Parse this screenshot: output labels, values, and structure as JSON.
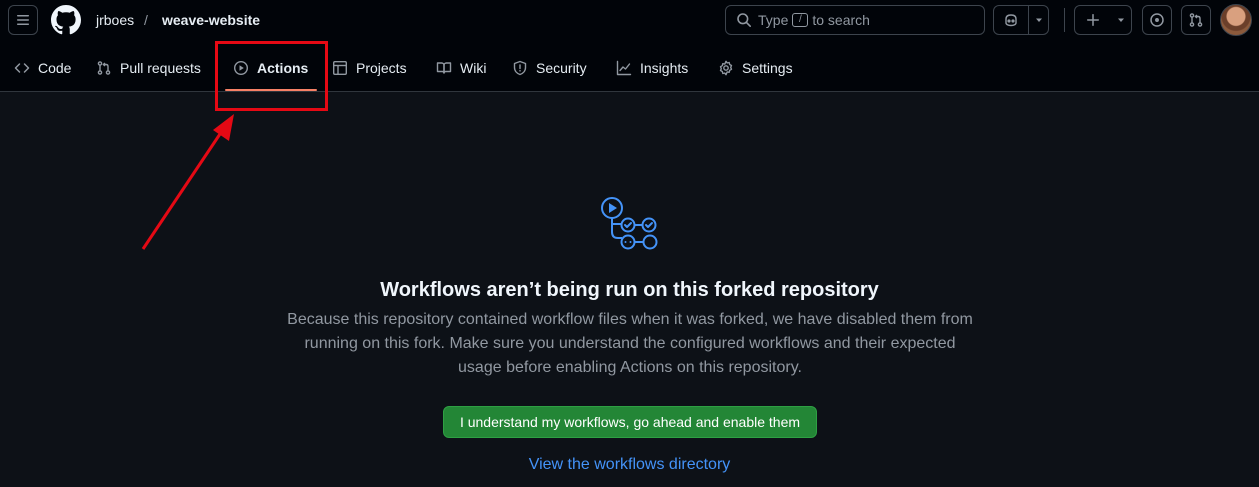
{
  "header": {
    "owner": "jrboes",
    "separator": "/",
    "repo": "weave-website",
    "search_prefix": "Type",
    "search_key": "/",
    "search_suffix": "to search",
    "icons": [
      "hamburger-menu-icon",
      "github-logo",
      "search-icon",
      "copilot-icon",
      "chevron-down-icon",
      "plus-icon",
      "issues-icon",
      "pull-request-icon"
    ]
  },
  "repo_nav": {
    "tabs": [
      {
        "label": "Code",
        "icon": "code-icon"
      },
      {
        "label": "Pull requests",
        "icon": "pull-request-icon"
      },
      {
        "label": "Actions",
        "icon": "play-icon",
        "active": true
      },
      {
        "label": "Projects",
        "icon": "table-icon"
      },
      {
        "label": "Wiki",
        "icon": "book-icon"
      },
      {
        "label": "Security",
        "icon": "shield-icon"
      },
      {
        "label": "Insights",
        "icon": "graph-icon"
      },
      {
        "label": "Settings",
        "icon": "gear-icon"
      }
    ],
    "active_underline_color": "#f78166"
  },
  "main": {
    "icon": "workflow-icon",
    "title": "Workflows aren’t being run on this forked repository",
    "description_lines": [
      "Because this repository contained workflow files when it was forked, we have disabled them from",
      "running on this fork. Make sure you understand the configured workflows and their expected",
      "usage before enabling Actions on this repository."
    ],
    "enable_button": "I understand my workflows, go ahead and enable them",
    "directory_link": "View the workflows directory"
  },
  "annotation": {
    "color": "#e50914",
    "target": "Actions"
  },
  "colors": {
    "background": "#0d1117",
    "header_bg": "#010409",
    "button_green": "#238636",
    "link_blue": "#4493f8",
    "accent_icon_blue": "#4493f8"
  }
}
